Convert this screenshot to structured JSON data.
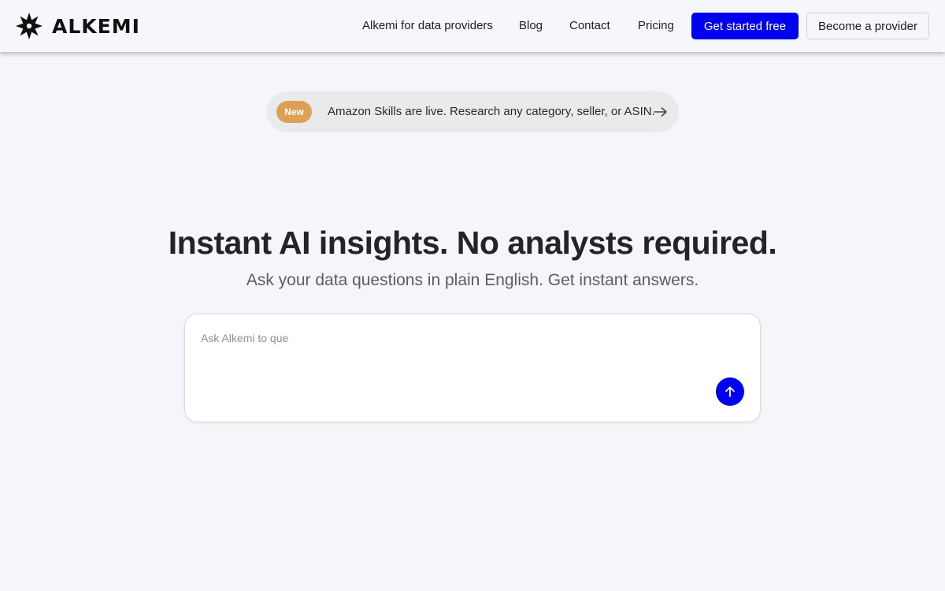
{
  "brand": {
    "name": "ALKEMI",
    "logo_icon": "star-burst-icon"
  },
  "nav": {
    "links": [
      "Alkemi for data providers",
      "Blog",
      "Contact",
      "Pricing"
    ],
    "primary_cta": "Get started free",
    "secondary_cta": "Become a provider"
  },
  "announcement": {
    "badge": "New",
    "text": "Amazon Skills are live. Research any category, seller, or ASIN.",
    "arrow_icon": "arrow-right-icon"
  },
  "hero": {
    "title": "Instant AI insights. No analysts required.",
    "subtitle": "Ask your data questions in plain English. Get instant answers."
  },
  "query": {
    "placeholder": "Ask Alkemi to que",
    "value": "",
    "send_icon": "arrow-up-icon"
  },
  "colors": {
    "accent": "#0000f0",
    "badge": "#dfa055",
    "background": "#f4f6fa"
  }
}
